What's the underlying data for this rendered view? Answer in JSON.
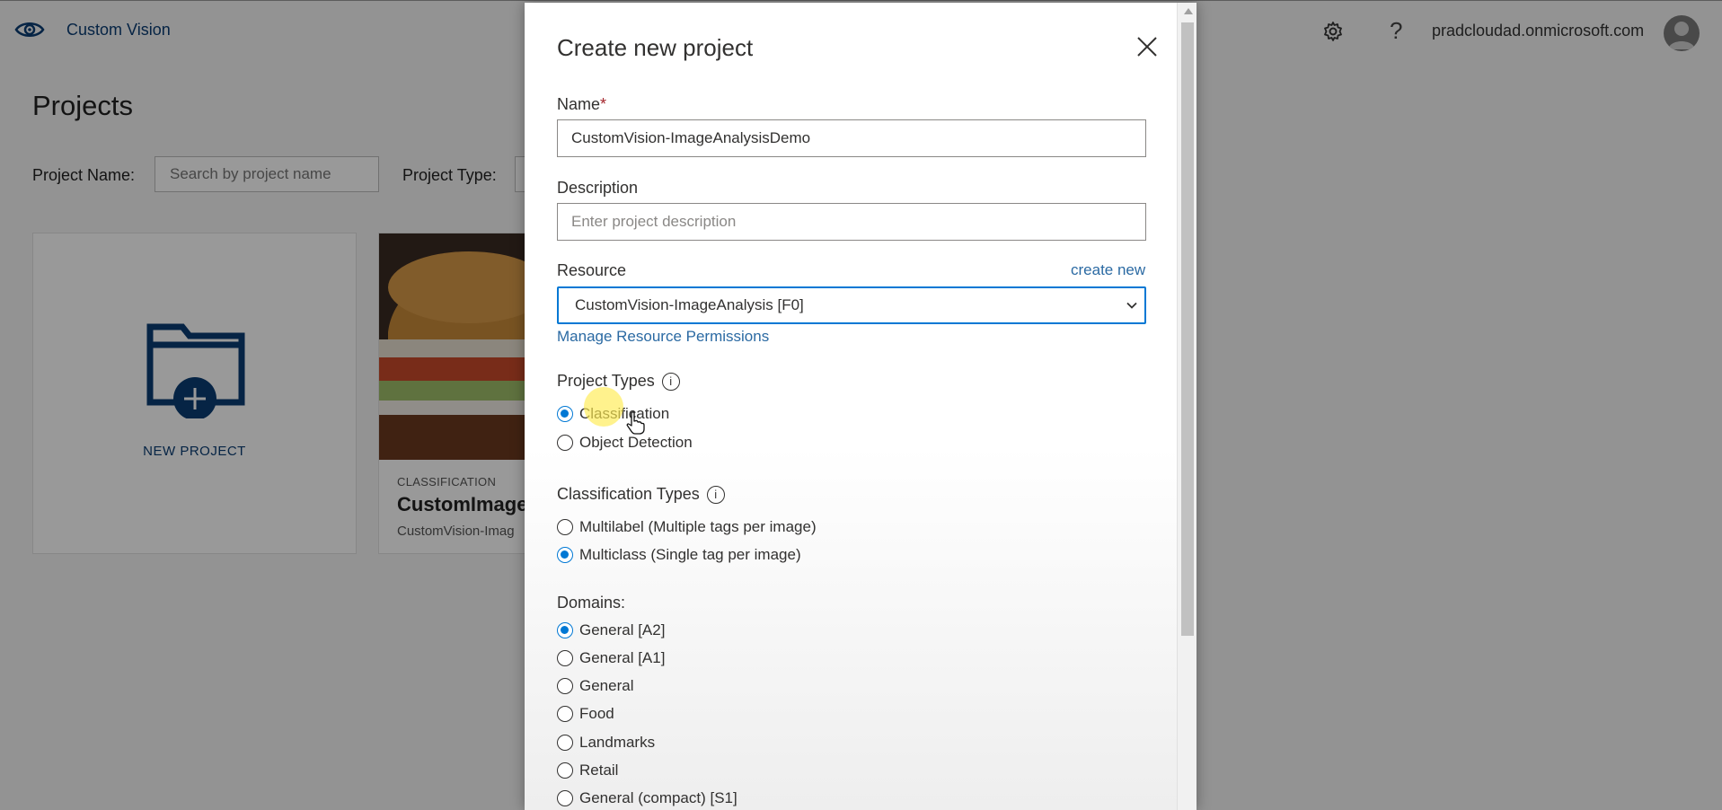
{
  "app": {
    "name": "Custom Vision",
    "account": "pradcloudad.onmicrosoft.com",
    "help_glyph": "?",
    "page_title": "Projects",
    "filters": {
      "project_name_label": "Project Name:",
      "search_placeholder": "Search by project name",
      "project_type_label": "Project Type:"
    },
    "new_project_label": "NEW PROJECT",
    "project_card": {
      "type": "CLASSIFICATION",
      "name": "CustomImageA",
      "subtitle": "CustomVision-Imag"
    }
  },
  "dialog": {
    "title": "Create new project",
    "name_label": "Name",
    "required_mark": "*",
    "name_value": "CustomVision-ImageAnalysisDemo",
    "description_label": "Description",
    "description_placeholder": "Enter project description",
    "resource_label": "Resource",
    "create_new_link": "create new",
    "resource_value": "CustomVision-ImageAnalysis [F0]",
    "manage_permissions_link": "Manage Resource Permissions",
    "project_types_label": "Project Types",
    "info_glyph": "i",
    "project_types": [
      {
        "label": "Classification",
        "checked": true
      },
      {
        "label": "Object Detection",
        "checked": false
      }
    ],
    "classification_types_label": "Classification Types",
    "classification_types": [
      {
        "label": "Multilabel (Multiple tags per image)",
        "checked": false
      },
      {
        "label": "Multiclass (Single tag per image)",
        "checked": true
      }
    ],
    "domains_label": "Domains:",
    "domains": [
      {
        "label": "General [A2]",
        "checked": true
      },
      {
        "label": "General [A1]",
        "checked": false
      },
      {
        "label": "General",
        "checked": false
      },
      {
        "label": "Food",
        "checked": false
      },
      {
        "label": "Landmarks",
        "checked": false
      },
      {
        "label": "Retail",
        "checked": false
      },
      {
        "label": "General (compact) [S1]",
        "checked": false
      }
    ]
  },
  "colors": {
    "accent": "#0078d4",
    "brand": "#0b3d73",
    "link": "#2b6aa3",
    "required": "#a4262c"
  },
  "icons": [
    "eye-logo-icon",
    "gear-icon",
    "help-icon",
    "avatar-icon",
    "folder-add-icon",
    "close-icon",
    "chevron-down-icon",
    "info-icon",
    "hand-pointer-icon"
  ]
}
